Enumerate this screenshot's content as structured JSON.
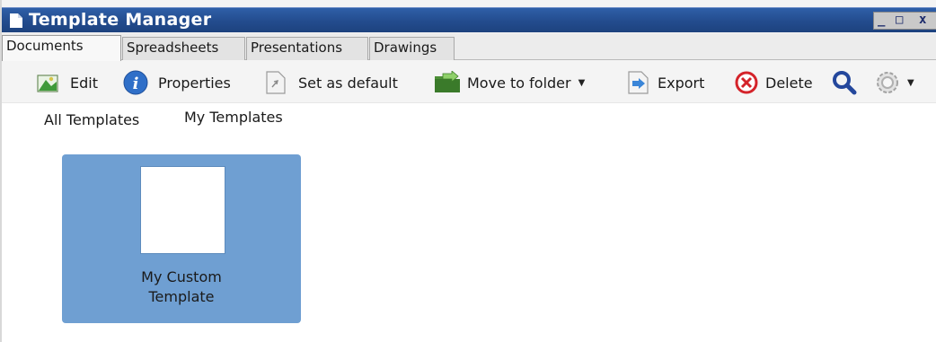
{
  "window": {
    "title": "Template Manager",
    "controls": {
      "minimize": "_",
      "maximize": "□",
      "close": "x"
    }
  },
  "tabs": [
    {
      "label": "Documents",
      "active": true
    },
    {
      "label": "Spreadsheets",
      "active": false
    },
    {
      "label": "Presentations",
      "active": false
    },
    {
      "label": "Drawings",
      "active": false
    }
  ],
  "toolbar": {
    "edit_label": "Edit",
    "properties_label": "Properties",
    "set_default_label": "Set as default",
    "move_to_folder_label": "Move to folder",
    "export_label": "Export",
    "delete_label": "Delete"
  },
  "filters": {
    "all_templates": "All Templates",
    "my_templates": "My Templates"
  },
  "templates": [
    {
      "name": "My Custom Template",
      "selected": true
    }
  ],
  "colors": {
    "titlebar": "#234c8e",
    "selection": "#6f9fd2",
    "delete_icon": "#d4232a",
    "properties_icon": "#2f6fc8"
  }
}
